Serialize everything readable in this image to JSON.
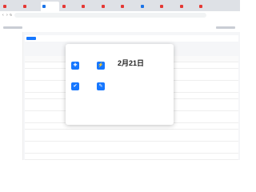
{
  "browser": {
    "tabs": [
      {
        "label": "",
        "color": "#e53935"
      },
      {
        "label": "",
        "color": "#e53935"
      },
      {
        "label": "",
        "color": "#1a73e8"
      },
      {
        "label": "",
        "color": "#e53935"
      },
      {
        "label": "",
        "color": "#e53935"
      },
      {
        "label": "",
        "color": "#e53935"
      },
      {
        "label": "",
        "color": "#e53935"
      },
      {
        "label": "",
        "color": "#1a73e8"
      },
      {
        "label": "",
        "color": "#e53935"
      },
      {
        "label": "",
        "color": "#e53935"
      },
      {
        "label": "",
        "color": "#e53935"
      }
    ],
    "url": ""
  },
  "popup": {
    "date": "2月21日",
    "tiles": [
      {
        "icon": "plus-icon",
        "glyph": "✚",
        "label": ""
      },
      {
        "icon": "lightning-icon",
        "glyph": "⚡",
        "label": ""
      },
      {
        "icon": "check-icon",
        "glyph": "✔",
        "label": ""
      },
      {
        "icon": "edit-icon",
        "glyph": "✎",
        "label": ""
      }
    ]
  }
}
